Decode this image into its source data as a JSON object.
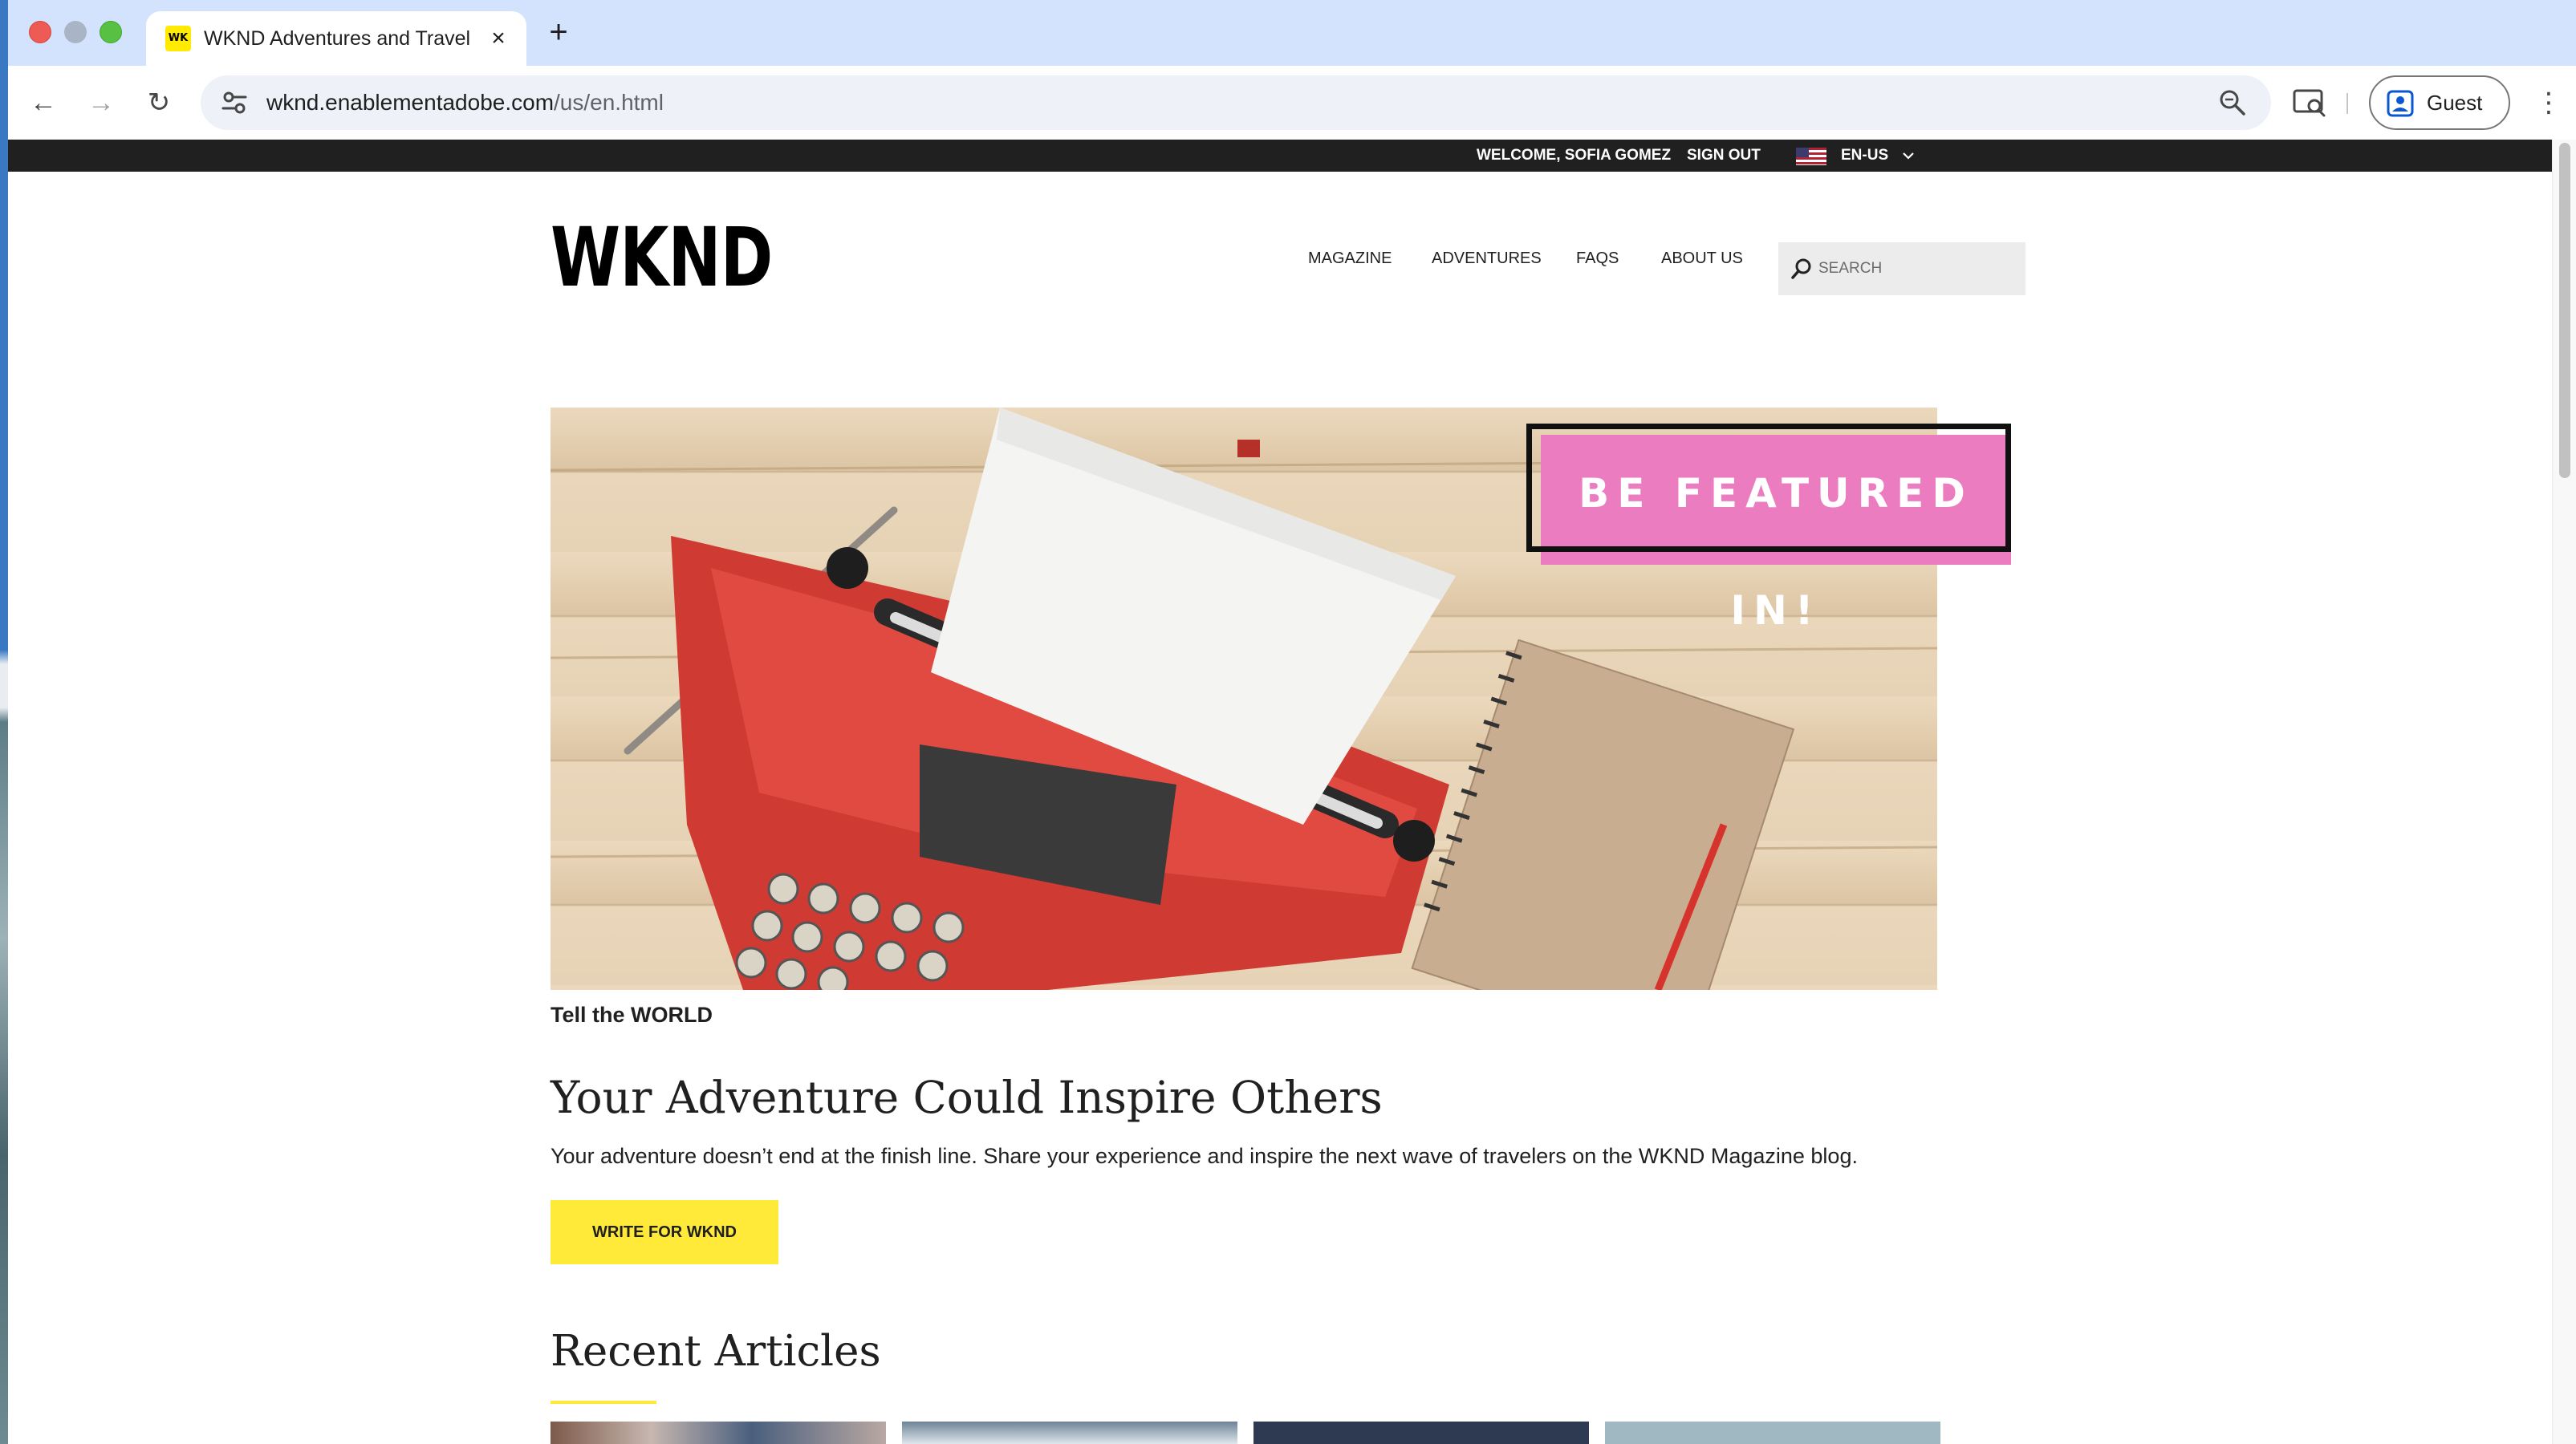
{
  "browser": {
    "tab_title": "WKND Adventures and Travel",
    "tab_favicon_text": "WK",
    "tab_close": "×",
    "new_tab": "+",
    "url_host": "wknd.enablementadobe.com",
    "url_path": "/us/en.html",
    "profile_label": "Guest",
    "back_glyph": "←",
    "forward_glyph": "→",
    "reload_glyph": "↻",
    "menu_glyph": "⋮"
  },
  "utility_bar": {
    "welcome": "WELCOME, SOFIA GOMEZ",
    "sign_out": "SIGN OUT",
    "language": "EN-US"
  },
  "header": {
    "logo": "WKND",
    "nav": [
      "MAGAZINE",
      "ADVENTURES",
      "FAQS",
      "ABOUT US"
    ],
    "search_placeholder": "SEARCH"
  },
  "hero": {
    "banner_text": "BE FEATURED IN!",
    "caption": "Tell the WORLD"
  },
  "content": {
    "headline": "Your Adventure Could Inspire Others",
    "body": "Your adventure doesn’t end at the finish line. Share your experience and inspire the next wave of travelers on the WKND Magazine blog.",
    "cta_label": "WRITE FOR WKND",
    "section_title": "Recent Articles"
  },
  "colors": {
    "accent_yellow": "#ffea3a",
    "banner_pink": "#eb7cc0",
    "utility_bar_bg": "#202020",
    "tab_strip_bg": "#d3e3fd"
  },
  "icons": [
    "site-info-icon",
    "zoom-icon",
    "cast-search-icon",
    "profile-icon",
    "search-icon",
    "chevron-down-icon",
    "us-flag-icon"
  ]
}
